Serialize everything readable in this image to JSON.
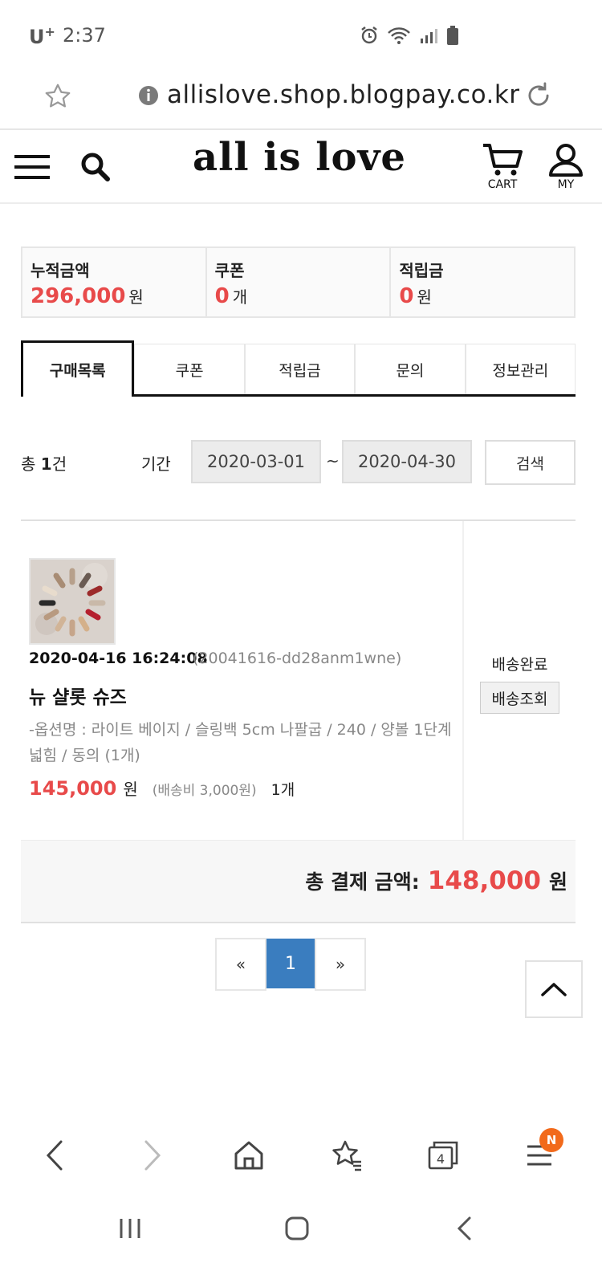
{
  "status_bar": {
    "carrier": "U",
    "carrier_sup": "+",
    "time": "2:37"
  },
  "browser": {
    "url": "allislove.shop.blogpay.co.kr",
    "tab_count": "4",
    "badge": "N"
  },
  "site": {
    "logo": "all is love",
    "cart_label": "CART",
    "my_label": "MY"
  },
  "summary": [
    {
      "label": "누적금액",
      "value": "296,000",
      "unit": "원"
    },
    {
      "label": "쿠폰",
      "value": "0",
      "unit": "개"
    },
    {
      "label": "적립금",
      "value": "0",
      "unit": "원"
    }
  ],
  "tabs": [
    "구매목록",
    "쿠폰",
    "적립금",
    "문의",
    "정보관리"
  ],
  "search": {
    "total_prefix": "총 ",
    "total_count": "1",
    "total_suffix": "건",
    "period_label": "기간",
    "date_from": "2020-03-01",
    "tilde": "~",
    "date_to": "2020-04-30",
    "button": "검색"
  },
  "order": {
    "datetime": "2020-04-16 16:24:08",
    "order_code": "(20041616-dd28anm1wne)",
    "product": "뉴 샬롯 슈즈",
    "options": "-옵션명 : 라이트 베이지 / 슬링백 5cm 나팔굽 / 240 / 양볼 1단계 넓힘 / 동의 (1개)",
    "price": "145,000",
    "price_unit": "원",
    "shipping": "(배송비 3,000원)",
    "qty": "1개",
    "status": "배송완료",
    "track_button": "배송조회"
  },
  "total": {
    "label": "총 결제 금액:",
    "value": "148,000",
    "unit": "원"
  },
  "pagination": {
    "prev": "«",
    "current": "1",
    "next": "»"
  },
  "colors": {
    "accent_red": "#e84a4a",
    "page_blue": "#3a7dbf",
    "badge_orange": "#f26a1b"
  }
}
